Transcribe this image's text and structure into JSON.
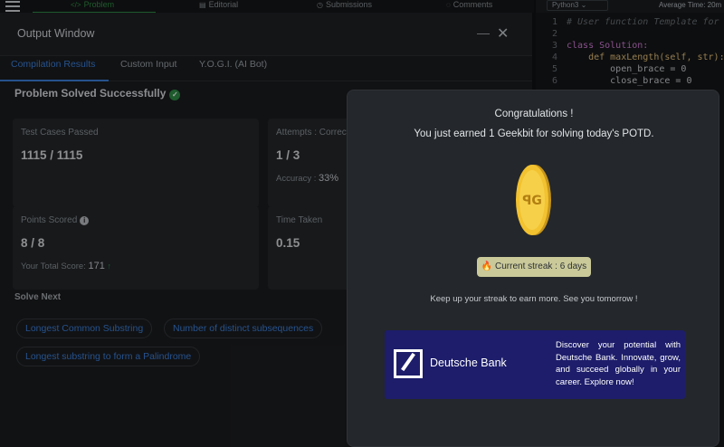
{
  "topbar": {
    "tabs": [
      {
        "label": "Problem",
        "icon": "code-icon"
      },
      {
        "label": "Editorial",
        "icon": "document-icon"
      },
      {
        "label": "Submissions",
        "icon": "clock-icon"
      },
      {
        "label": "Comments",
        "icon": "comment-icon"
      }
    ],
    "active_color": "#2f8d46"
  },
  "output_window": {
    "title": "Output Window",
    "minimize": "—",
    "close": "✕",
    "tabs": [
      "Compilation Results",
      "Custom Input",
      "Y.O.G.I. (AI Bot)"
    ],
    "status": "Problem Solved Successfully",
    "cards": {
      "test_cases": {
        "label": "Test Cases Passed",
        "value": "1115 / 1115"
      },
      "attempts": {
        "label": "Attempts : Correct / Total",
        "value": "1 / 3",
        "sub_label": "Accuracy :",
        "sub_value": "33%"
      },
      "points": {
        "label": "Points Scored",
        "value": "8 / 8",
        "sub_label": "Your Total Score:",
        "sub_value": "171"
      },
      "time": {
        "label": "Time Taken",
        "value": "0.15"
      }
    },
    "solve_next_label": "Solve Next",
    "solve_next": [
      "Longest Common Substring",
      "Number of distinct subsequences",
      "Longest substring to form a Palindrome"
    ]
  },
  "editor": {
    "language": "Python3",
    "avg_time": "Average Time: 20m",
    "lines": [
      {
        "n": "1",
        "code": "# User function Template for P"
      },
      {
        "n": "2",
        "code": ""
      },
      {
        "n": "3",
        "code": "class Solution:"
      },
      {
        "n": "4",
        "code": "    def maxLength(self, str):"
      },
      {
        "n": "5",
        "code": "        open_brace = 0"
      },
      {
        "n": "6",
        "code": "        close_brace = 0"
      }
    ]
  },
  "modal": {
    "title": "Congratulations !",
    "message": "You just earned 1 Geekbit for solving today's POTD.",
    "streak": "🔥 Current streak : 6 days",
    "footer": "Keep up your streak to earn more. See you tomorrow !",
    "ad": {
      "brand": "Deutsche Bank",
      "text": "Discover your potential with Deutsche Bank. Innovate, grow, and succeed globally in your career. Explore now!"
    },
    "colors": {
      "coin": "#f2c230",
      "ad_bg": "#1d1d6b"
    }
  }
}
